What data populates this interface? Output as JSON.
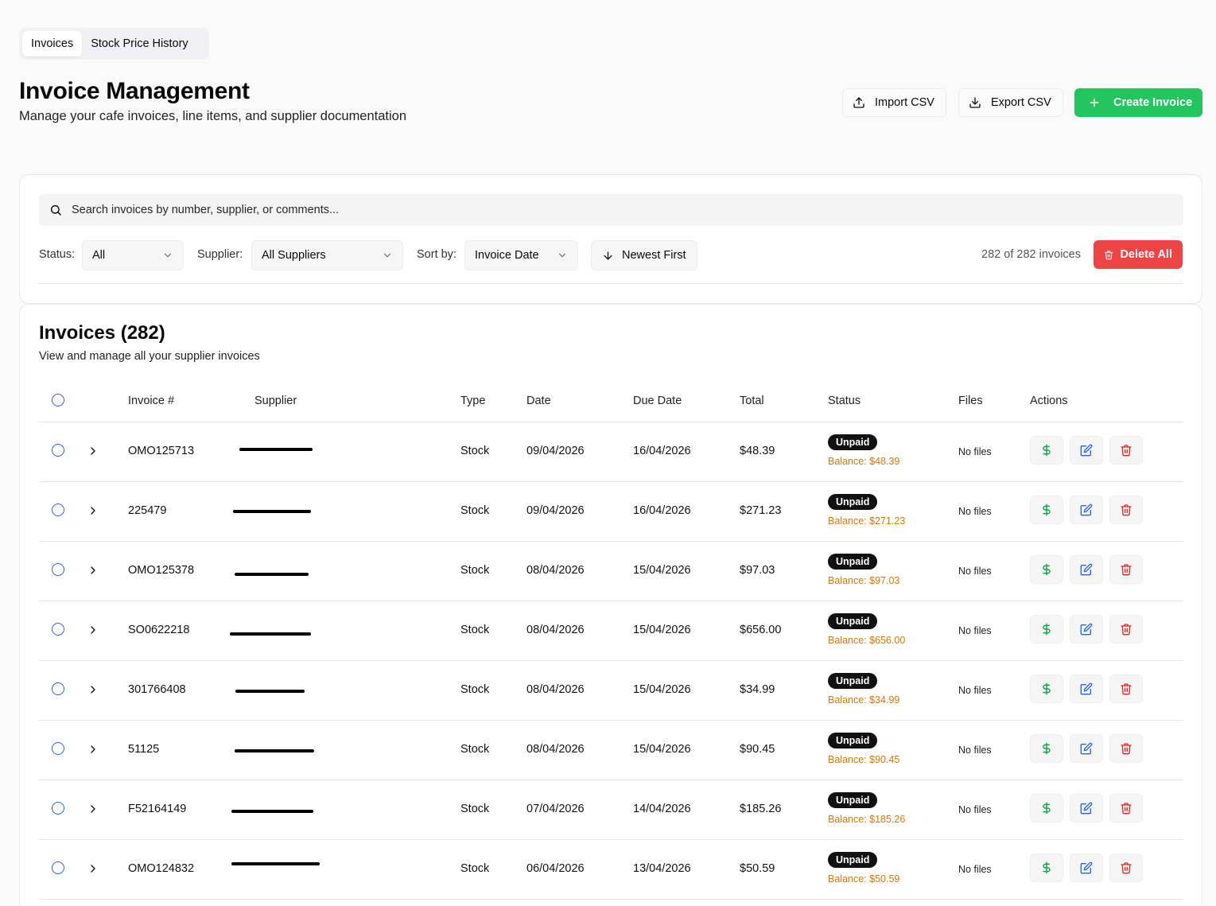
{
  "tabs": [
    {
      "label": "Invoices",
      "active": true
    },
    {
      "label": "Stock Price History",
      "active": false
    }
  ],
  "header": {
    "title": "Invoice Management",
    "subtitle": "Manage your cafe invoices, line items, and supplier documentation",
    "import_label": "Import CSV",
    "export_label": "Export CSV",
    "create_label": "Create Invoice"
  },
  "filters": {
    "search_placeholder": "Search invoices by number, supplier, or comments...",
    "status_label": "Status:",
    "status_value": "All",
    "supplier_label": "Supplier:",
    "supplier_value": "All Suppliers",
    "sort_label": "Sort by:",
    "sort_value": "Invoice Date",
    "order_label": "Newest First",
    "count_text": "282 of 282 invoices",
    "delete_all_label": "Delete All"
  },
  "list": {
    "title": "Invoices (282)",
    "subtitle": "View and manage all your supplier invoices",
    "columns": {
      "invoice": "Invoice #",
      "supplier": "Supplier",
      "type": "Type",
      "date": "Date",
      "due": "Due Date",
      "total": "Total",
      "status": "Status",
      "files": "Files",
      "actions": "Actions"
    },
    "rows": [
      {
        "invoice": "OMO125713",
        "type": "Stock",
        "date": "09/04/2026",
        "due": "16/04/2026",
        "total": "$48.39",
        "status": "Unpaid",
        "balance": "Balance: $48.39",
        "files": "No files"
      },
      {
        "invoice": "225479",
        "type": "Stock",
        "date": "09/04/2026",
        "due": "16/04/2026",
        "total": "$271.23",
        "status": "Unpaid",
        "balance": "Balance: $271.23",
        "files": "No files"
      },
      {
        "invoice": "OMO125378",
        "type": "Stock",
        "date": "08/04/2026",
        "due": "15/04/2026",
        "total": "$97.03",
        "status": "Unpaid",
        "balance": "Balance: $97.03",
        "files": "No files"
      },
      {
        "invoice": "SO0622218",
        "type": "Stock",
        "date": "08/04/2026",
        "due": "15/04/2026",
        "total": "$656.00",
        "status": "Unpaid",
        "balance": "Balance: $656.00",
        "files": "No files"
      },
      {
        "invoice": "301766408",
        "type": "Stock",
        "date": "08/04/2026",
        "due": "15/04/2026",
        "total": "$34.99",
        "status": "Unpaid",
        "balance": "Balance: $34.99",
        "files": "No files"
      },
      {
        "invoice": "51125",
        "type": "Stock",
        "date": "08/04/2026",
        "due": "15/04/2026",
        "total": "$90.45",
        "status": "Unpaid",
        "balance": "Balance: $90.45",
        "files": "No files"
      },
      {
        "invoice": "F52164149",
        "type": "Stock",
        "date": "07/04/2026",
        "due": "14/04/2026",
        "total": "$185.26",
        "status": "Unpaid",
        "balance": "Balance: $185.26",
        "files": "No files"
      },
      {
        "invoice": "OMO124832",
        "type": "Stock",
        "date": "06/04/2026",
        "due": "13/04/2026",
        "total": "$50.59",
        "status": "Unpaid",
        "balance": "Balance: $50.59",
        "files": "No files"
      }
    ]
  },
  "colors": {
    "primary_green": "#22c55e",
    "danger_red": "#ef4444",
    "balance_orange": "#d97706",
    "edit_blue": "#2563eb",
    "pay_green": "#16a34a"
  },
  "icons": {
    "import": "upload-icon",
    "export": "download-icon",
    "create": "plus-icon",
    "search": "search-icon",
    "dropdown": "chevron-down-icon",
    "order": "arrow-down-icon",
    "delete_all": "trash-icon",
    "expand": "chevron-right-icon",
    "pay": "dollar-icon",
    "edit": "edit-icon",
    "delete": "trash-icon"
  }
}
